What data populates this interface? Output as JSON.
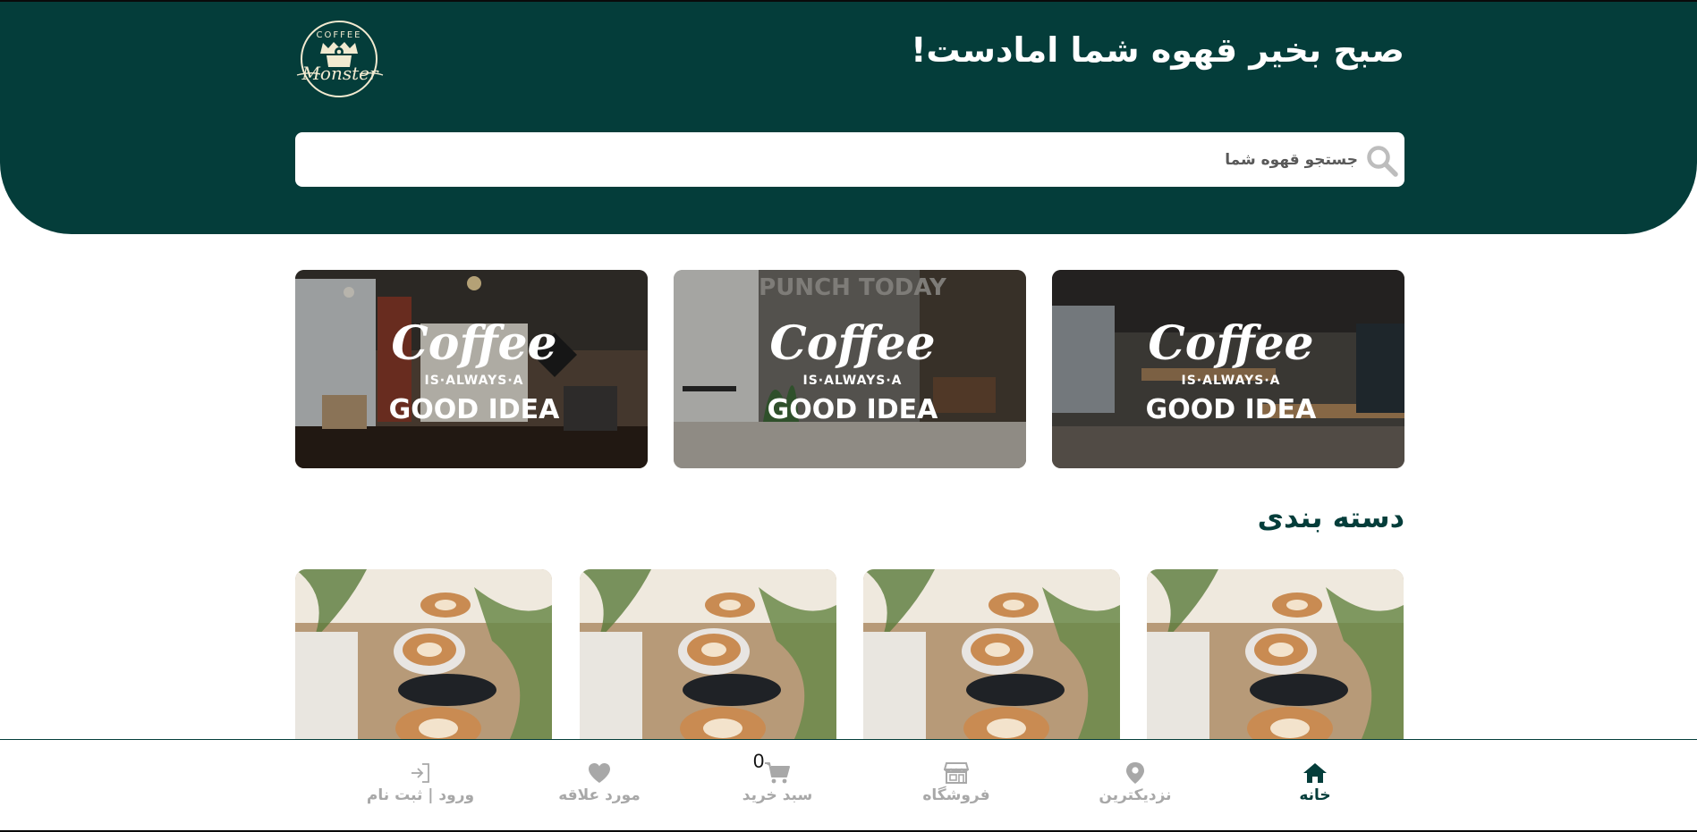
{
  "header": {
    "greeting": "صبح بخیر قهوه شما امادست!",
    "logo": {
      "top_text": "COFFEE",
      "script_text": "Monster"
    },
    "background_color": "#043d3a"
  },
  "search": {
    "placeholder": "جستجو قهوه شما",
    "icon": "search-icon"
  },
  "banners": [
    {
      "line1": "Coffee",
      "line2": "IS·ALWAYS·A",
      "line3": "GOOD IDEA"
    },
    {
      "line1": "Coffee",
      "line2": "IS·ALWAYS·A",
      "line3": "GOOD IDEA",
      "wall_text": "PUNCH TODAY"
    },
    {
      "line1": "Coffee",
      "line2": "IS·ALWAYS·A",
      "line3": "GOOD IDEA"
    }
  ],
  "categories_section": {
    "title": "دسته بندی",
    "cards": [
      {
        "image": "latte-cups-photo"
      },
      {
        "image": "latte-cups-photo"
      },
      {
        "image": "latte-cups-photo"
      },
      {
        "image": "latte-cups-photo"
      }
    ]
  },
  "bottom_nav": {
    "active": "home",
    "items": [
      {
        "id": "home",
        "label": "خانه",
        "icon": "home-icon"
      },
      {
        "id": "nearest",
        "label": "نزدیکترین",
        "icon": "map-pin-icon"
      },
      {
        "id": "shop",
        "label": "فروشگاه",
        "icon": "store-icon"
      },
      {
        "id": "cart",
        "label": "سبد خرید",
        "icon": "cart-icon",
        "badge": "0"
      },
      {
        "id": "favorites",
        "label": "مورد علاقه",
        "icon": "heart-icon"
      },
      {
        "id": "login",
        "label": "ورود | ثبت نام",
        "icon": "login-icon"
      }
    ]
  },
  "colors": {
    "brand_dark_green": "#043d3a",
    "inactive_gray": "#a8a8a8",
    "logo_cream": "#f2ead0"
  }
}
